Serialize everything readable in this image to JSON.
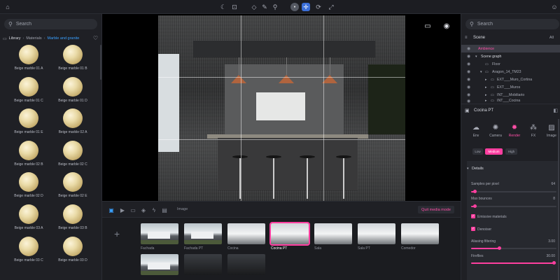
{
  "library": {
    "search_placeholder": "Search",
    "breadcrumb": [
      "Library",
      "Materials",
      "Marble and granite"
    ],
    "materials": [
      "Beige marble 01 A",
      "Beige marble 01 B",
      "Beige marble 01 C",
      "Beige marble 01 D",
      "Beige marble 01 E",
      "Beige marble 02 A",
      "Beige marble 02 B",
      "Beige marble 02 C",
      "Beige marble 02 D",
      "Beige marble 02 E",
      "Beige marble 03 A",
      "Beige marble 03 B",
      "Beige marble 03 C",
      "Beige marble 03 D"
    ]
  },
  "scenebar": {
    "label": "Image",
    "quit_label": "Quit media mode"
  },
  "views": [
    {
      "label": "Fachada"
    },
    {
      "label": "Fachada PT"
    },
    {
      "label": "Cocina"
    },
    {
      "label": "Cocina PT"
    },
    {
      "label": "Sala"
    },
    {
      "label": "Sala PT"
    },
    {
      "label": "Comedor"
    }
  ],
  "scene": {
    "search_placeholder": "Search",
    "title": "Scene",
    "filter": "All",
    "tree": [
      {
        "label": "Ambience"
      },
      {
        "label": "Scene graph"
      },
      {
        "label": "Floor"
      },
      {
        "label": "Aragon_14_TM23"
      },
      {
        "label": "EXT___Muro_Cortina"
      },
      {
        "label": "EXT___Muros"
      },
      {
        "label": "INT___Mobiliario"
      },
      {
        "label": "INT___Cocina"
      }
    ]
  },
  "properties": {
    "title": "Cocina PT",
    "tabs": [
      "Env",
      "Camera",
      "Render",
      "FX",
      "Image"
    ],
    "quality": [
      "Low",
      "Medium",
      "High"
    ],
    "section": "Details",
    "samples_label": "Samples per pixel",
    "samples_value": "64",
    "bounces_label": "Max bounces",
    "bounces_value": "8",
    "emissive_label": "Emissive materials",
    "denoiser_label": "Denoiser",
    "filtering_label": "Aliasing filtering",
    "filtering_value": "3.00",
    "fireflies_label": "Fireflies",
    "fireflies_value": "30.00"
  },
  "colors": {
    "accent": "#ff3fa0",
    "link": "#3aa0ff",
    "active_tool": "#3b6fd8"
  }
}
